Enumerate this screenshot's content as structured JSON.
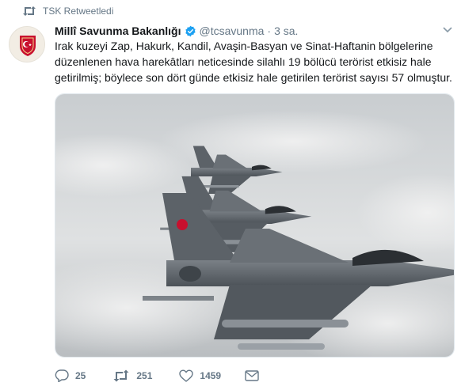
{
  "retweet_banner": {
    "icon": "retweet-icon",
    "text": "TSK Retweetledi"
  },
  "tweet": {
    "author": {
      "display_name": "Millî Savunma Bakanlığı",
      "verified": true,
      "handle": "@tcsavunma",
      "separator": "·",
      "time": "3 sa."
    },
    "text": "Irak kuzeyi Zap, Hakurk, Kandil, Avaşin-Basyan ve Sinat-Haftanin bölgelerine düzenlenen hava harekâtları neticesinde silahlı 19 bölücü terörist etkisiz hale getirilmiş; böylece son dört günde etkisiz hale getirilen terörist sayısı 57 olmuştur.",
    "media": {
      "kind": "photo",
      "icon": "fighter-jets-photo"
    },
    "actions": {
      "reply_count": "25",
      "retweet_count": "251",
      "like_count": "1459"
    }
  },
  "colors": {
    "accent": "#1da1f2",
    "muted": "#657786",
    "text": "#14171a",
    "avatar_red": "#c8102e"
  }
}
